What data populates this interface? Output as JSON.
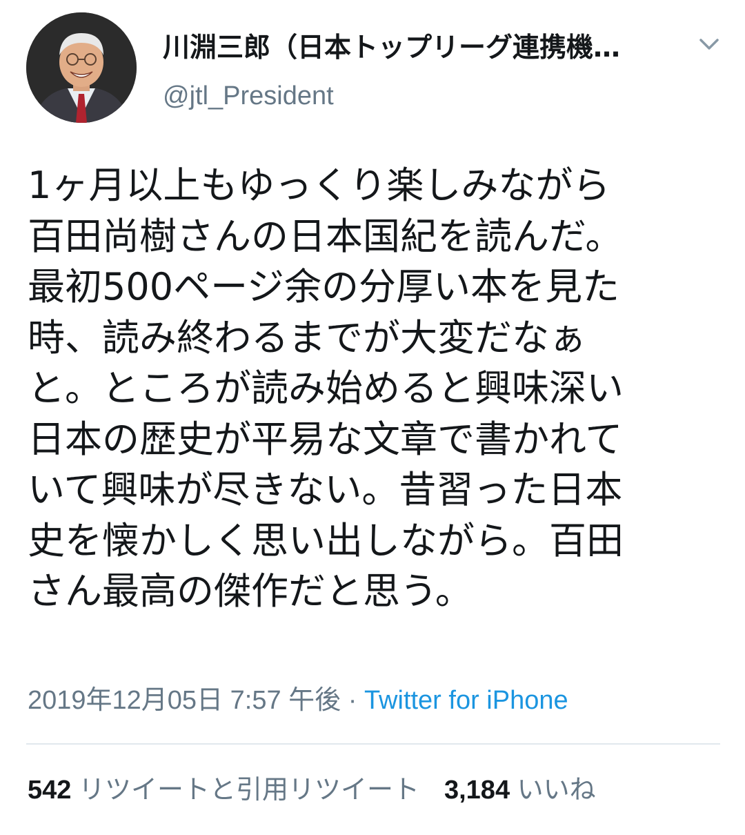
{
  "author": {
    "display_name": "川淵三郎（日本トップリーグ連携機…",
    "handle": "@jtl_President",
    "avatar_icon": "person-avatar"
  },
  "tweet": {
    "lines": [
      "1ヶ月以上もゆっくり楽しみながら",
      "百田尚樹さんの日本国紀を読んだ。",
      "最初500ページ余の分厚い本を見た",
      "時、読み終わるまでが大変だなぁ",
      "と。ところが読み始めると興味深い",
      "日本の歴史が平易な文章で書かれて",
      "いて興味が尽きない。昔習った日本",
      "史を懐かしく思い出しながら。百田",
      "さん最高の傑作だと思う。"
    ],
    "timestamp": "2019年12月05日 7:57 午後",
    "separator": " · ",
    "source": "Twitter for iPhone"
  },
  "stats": {
    "retweets_count": "542",
    "retweets_label": "リツイートと引用リツイート",
    "likes_count": "3,184",
    "likes_label": "いいね"
  },
  "colors": {
    "text": "#14171a",
    "secondary": "#657786",
    "link": "#1b95e0",
    "divider": "#e1e8ed"
  }
}
